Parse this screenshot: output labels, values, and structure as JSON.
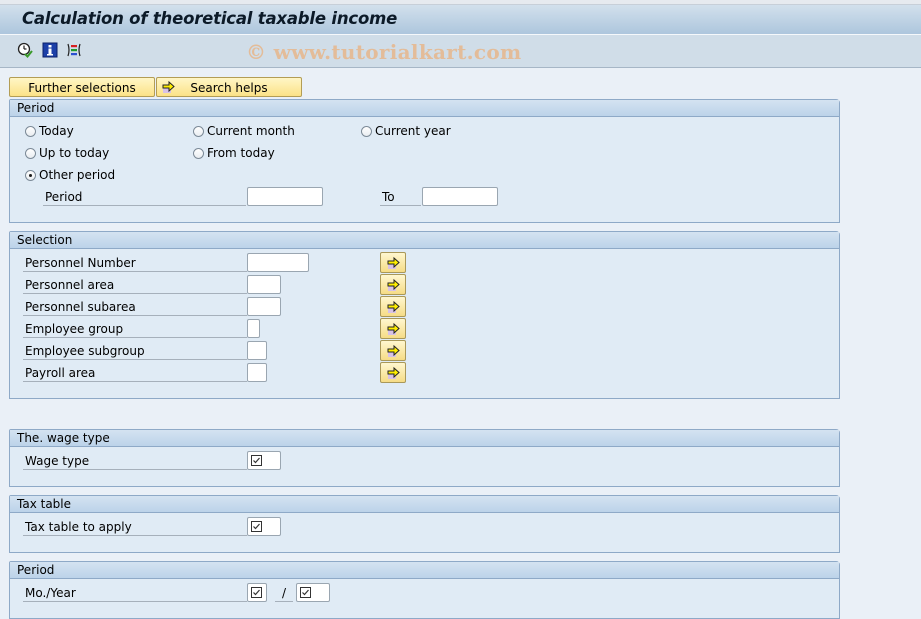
{
  "window": {
    "title": "Calculation of theoretical taxable income",
    "watermark": "© www.tutorialkart.com"
  },
  "toolbar": {
    "icons": [
      "execute-clock-icon",
      "info-icon",
      "selection-options-icon"
    ]
  },
  "buttons": {
    "further_selections": "Further selections",
    "search_helps": "Search helps"
  },
  "period_group": {
    "title": "Period",
    "radios": [
      {
        "label": "Today",
        "selected": false
      },
      {
        "label": "Current month",
        "selected": false
      },
      {
        "label": "Current year",
        "selected": false
      },
      {
        "label": "Up to today",
        "selected": false
      },
      {
        "label": "From today",
        "selected": false
      },
      {
        "label": "Other period",
        "selected": true
      }
    ],
    "period_label": "Period",
    "period_from_value": "",
    "to_label": "To",
    "period_to_value": ""
  },
  "selection_group": {
    "title": "Selection",
    "fields": [
      {
        "label": "Personnel Number",
        "value": ""
      },
      {
        "label": "Personnel area",
        "value": ""
      },
      {
        "label": "Personnel subarea",
        "value": ""
      },
      {
        "label": "Employee group",
        "value": ""
      },
      {
        "label": "Employee subgroup",
        "value": ""
      },
      {
        "label": "Payroll area",
        "value": ""
      }
    ]
  },
  "wage_type_group": {
    "title": "The. wage type",
    "field_label": "Wage type",
    "required": true
  },
  "tax_table_group": {
    "title": "Tax table",
    "field_label": "Tax table to apply",
    "required": true
  },
  "period2_group": {
    "title": "Period",
    "field_label": "Mo./Year",
    "separator": "/",
    "month_required": true,
    "year_required": true
  }
}
